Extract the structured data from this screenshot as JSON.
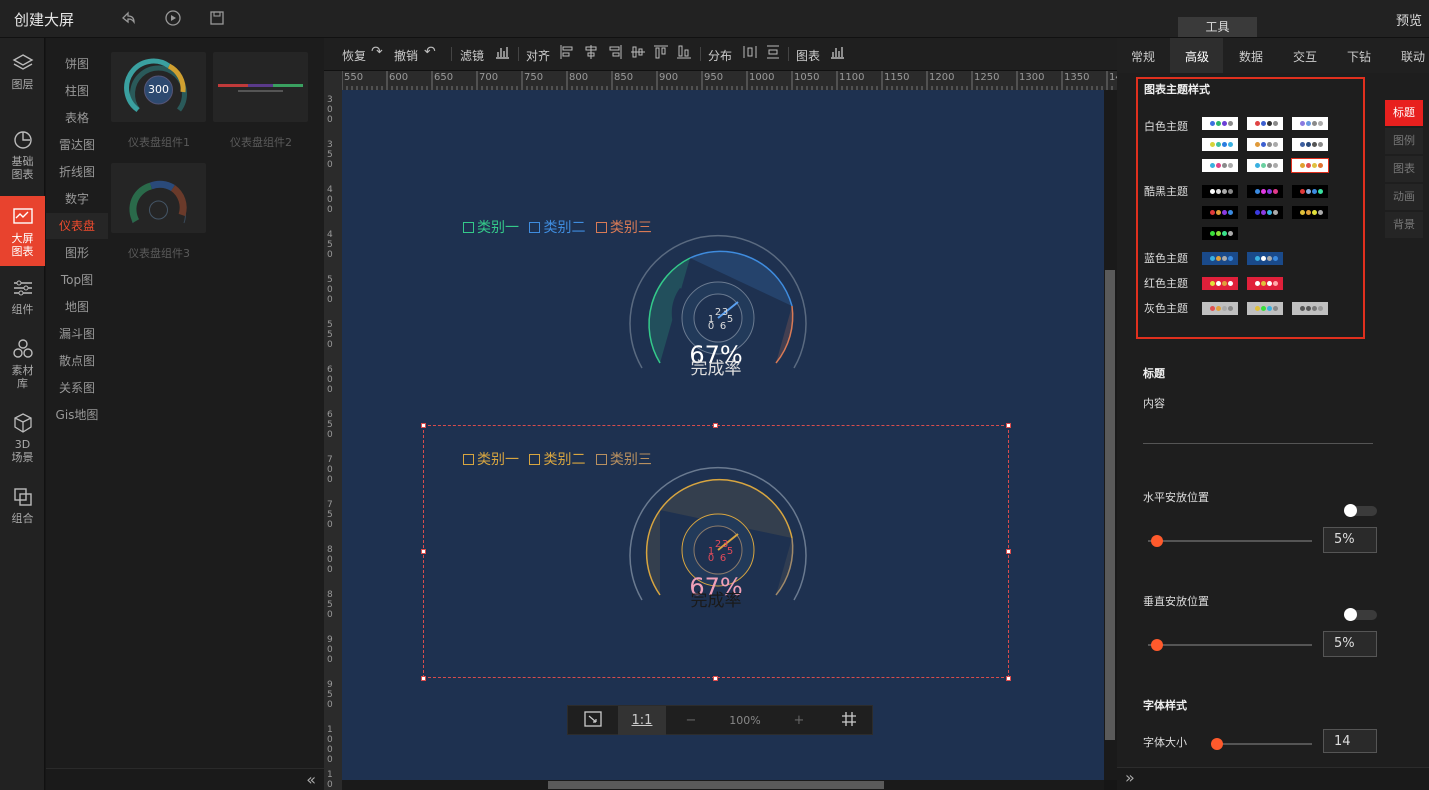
{
  "app": {
    "title": "创建大屏",
    "preview": "预览",
    "tools_tab": "工具"
  },
  "leftnav": [
    {
      "label": "图层",
      "icon": "layers-icon"
    },
    {
      "label": "基础图表",
      "icon": "pie-chart-icon"
    },
    {
      "label": "大屏图表",
      "icon": "dashboard-chart-icon",
      "active": true
    },
    {
      "label": "组件",
      "icon": "sliders-icon"
    },
    {
      "label": "素材库",
      "icon": "material-icon"
    },
    {
      "label": "3D场景",
      "icon": "cube-icon"
    },
    {
      "label": "组合",
      "icon": "combine-icon"
    }
  ],
  "categories": [
    "饼图",
    "柱图",
    "表格",
    "雷达图",
    "折线图",
    "数字",
    "仪表盘",
    "图形",
    "Top图",
    "地图",
    "漏斗图",
    "散点图",
    "关系图",
    "Gis地图"
  ],
  "active_category": "仪表盘",
  "thumbs": [
    "仪表盘组件1",
    "仪表盘组件2",
    "仪表盘组件3"
  ],
  "thumb_gauge_value": "300",
  "toolbar": {
    "redo": "恢复",
    "undo": "撤销",
    "filter": "滤镜",
    "align": "对齐",
    "distribute": "分布",
    "chart": "图表"
  },
  "ruler_h": [
    "550",
    "600",
    "650",
    "700",
    "750",
    "800",
    "850",
    "900",
    "950",
    "1000",
    "1050",
    "1100",
    "1150",
    "1200",
    "1250",
    "1300",
    "1350",
    "14"
  ],
  "ruler_v": [
    "300",
    "350",
    "400",
    "450",
    "500",
    "550",
    "600",
    "650",
    "700",
    "750",
    "800",
    "850",
    "900",
    "950",
    "1000",
    "10"
  ],
  "canvas": {
    "gauge1": {
      "legend": [
        "类别一",
        "类别二",
        "类别三"
      ],
      "legend_colors": [
        "#34c98a",
        "#3f8cde",
        "#d87a56"
      ],
      "value": "67%",
      "label": "完成率",
      "ticks": [
        "2",
        "3",
        "1",
        "5",
        "0",
        "6"
      ]
    },
    "gauge2": {
      "legend": [
        "类别一",
        "类别二",
        "类别三"
      ],
      "legend_colors": [
        "#d7a540",
        "#d7a540",
        "#b89060"
      ],
      "value": "67%",
      "label": "完成率",
      "ticks": [
        "2",
        "3",
        "1",
        "5",
        "0",
        "6"
      ]
    }
  },
  "zoom": {
    "ratio": "1:1",
    "minus": "−",
    "value": "100%",
    "plus": "+"
  },
  "right_tabs": [
    "常规",
    "高级",
    "数据",
    "交互",
    "下钻",
    "联动"
  ],
  "active_right_tab": "高级",
  "theme": {
    "title": "图表主题样式",
    "groups": [
      {
        "name": "白色主题",
        "bg": "#ffffff",
        "swatches": [
          [
            "#3d6fe0",
            "#2fb56a",
            "#6b3fd6",
            "#8a8a8a"
          ],
          [
            "#e04444",
            "#3d5fd0",
            "#333",
            "#8a8a8a"
          ],
          [
            "#8a7ae0",
            "#6a9ae0",
            "#8a8a8a",
            "#aaa"
          ],
          [
            "#d6d43a",
            "#3dc0a0",
            "#2a7de0",
            "#3ab0e0"
          ],
          [
            "#e09a3a",
            "#3d5fd0",
            "#8a8a8a",
            "#aaa"
          ],
          [
            "#3d5fa0",
            "#2a4a7a",
            "#555",
            "#8a8a8a"
          ],
          [
            "#3ab0e0",
            "#e04488",
            "#8a8a8a",
            "#aaa"
          ],
          [
            "#3ab0e0",
            "#6ad0a0",
            "#8a8a8a",
            "#aaa"
          ],
          [
            "#e0a030",
            "#e05050",
            "#e0c040",
            "#e07030"
          ]
        ]
      },
      {
        "name": "酷黑主题",
        "bg": "#000000",
        "swatches": [
          [
            "#ffffff",
            "#dddddd",
            "#aaaaaa",
            "#888888"
          ],
          [
            "#3a8ae0",
            "#e03ae0",
            "#8a3ae0",
            "#e03a8a"
          ],
          [
            "#e03a3a",
            "#8ab0e0",
            "#3a8ae0",
            "#3ae0a0"
          ],
          [
            "#e03a3a",
            "#e0a03a",
            "#8a3ae0",
            "#3a8ae0"
          ],
          [
            "#3a3ae0",
            "#8a3ae0",
            "#3ab0e0",
            "#aaa"
          ],
          [
            "#e0c03a",
            "#e0a03a",
            "#e0e03a",
            "#aaa"
          ],
          [
            "#3ae03a",
            "#8ae03a",
            "#3ae08a",
            "#aaa"
          ]
        ]
      },
      {
        "name": "蓝色主题",
        "bg": "#1a4a8a",
        "swatches": [
          [
            "#3ab0e0",
            "#e0a03a",
            "#aaa",
            "#3a8ae0"
          ],
          [
            "#3ab0e0",
            "#ffffff",
            "#aaa",
            "#3a8ae0"
          ]
        ]
      },
      {
        "name": "红色主题",
        "bg": "#e0203a",
        "swatches": [
          [
            "#e0e03a",
            "#ffffff",
            "#e0a03a",
            "#ffffff"
          ],
          [
            "#ffffff",
            "#e0c03a",
            "#ffffff",
            "#ffaaaa"
          ]
        ]
      },
      {
        "name": "灰色主题",
        "bg": "#c0c0c0",
        "swatches": [
          [
            "#e05050",
            "#e0a03a",
            "#aaa",
            "#888"
          ],
          [
            "#e0c03a",
            "#3ae03a",
            "#3ab0e0",
            "#888"
          ],
          [
            "#555",
            "#555",
            "#777",
            "#999"
          ]
        ]
      }
    ]
  },
  "side_tabs": [
    "标题",
    "图例",
    "图表",
    "动画",
    "背景"
  ],
  "active_side_tab": "标题",
  "props": {
    "section_title": "标题",
    "content_label": "内容",
    "h_pos_label": "水平安放位置",
    "h_pos_value": "5%",
    "v_pos_label": "垂直安放位置",
    "v_pos_value": "5%",
    "font_style_label": "字体样式",
    "font_size_label": "字体大小",
    "font_size_value": "14"
  },
  "colors": {
    "accent": "#e8432e",
    "canvas_bg": "#1e3150",
    "panel_bg": "#1e1e1e"
  }
}
